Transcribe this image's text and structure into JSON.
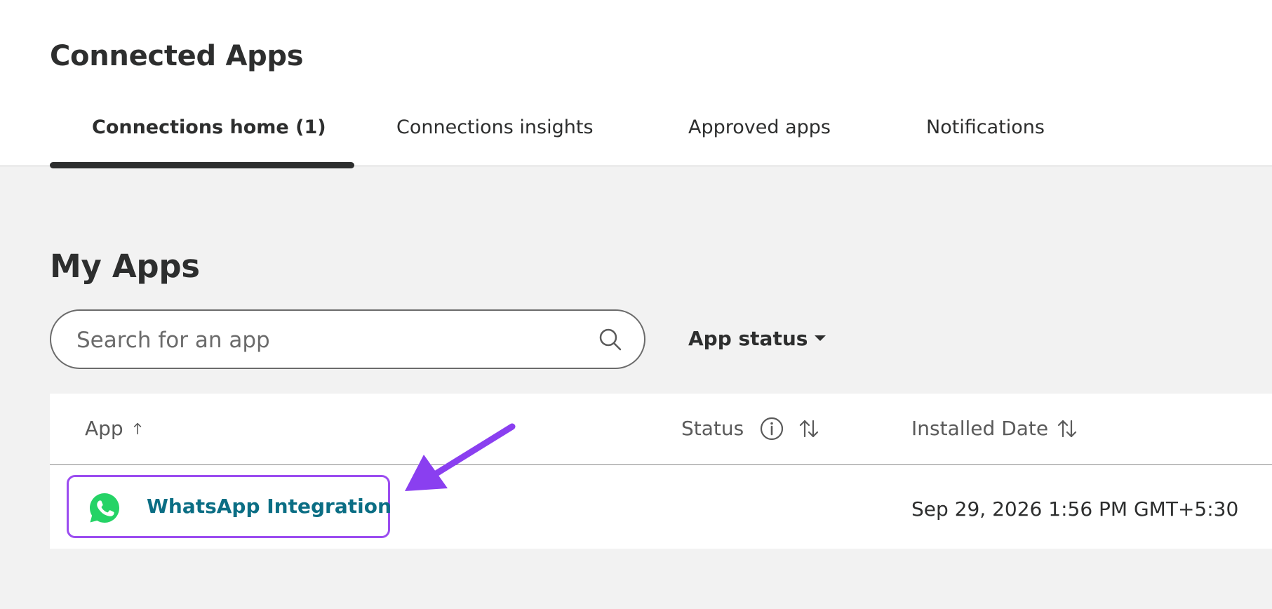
{
  "page": {
    "title": "Connected Apps"
  },
  "tabs": [
    {
      "label": "Connections home (1)",
      "active": true
    },
    {
      "label": "Connections insights",
      "active": false
    },
    {
      "label": "Approved apps",
      "active": false
    },
    {
      "label": "Notifications",
      "active": false
    }
  ],
  "my_apps": {
    "title": "My Apps",
    "search": {
      "placeholder": "Search for an app",
      "value": ""
    },
    "filter": {
      "label": "App status"
    },
    "table": {
      "columns": {
        "app": "App",
        "status": "Status",
        "installed_date": "Installed Date"
      },
      "rows": [
        {
          "app": "WhatsApp Integration",
          "status": "",
          "installed_date": "Sep 29, 2026 1:56 PM GMT+5:30"
        }
      ]
    }
  },
  "colors": {
    "link": "#0b6e84",
    "highlight": "#9b4cf0",
    "whatsapp": "#25d366",
    "text": "#2d2e2e",
    "background": "#f2f2f2"
  },
  "icons": {
    "search": "search-icon",
    "dropdown": "chevron-down-icon",
    "sort_asc": "arrow-up-icon",
    "sort": "sort-icon",
    "info": "info-icon",
    "app": "whatsapp-icon",
    "annotation": "arrow-icon"
  }
}
